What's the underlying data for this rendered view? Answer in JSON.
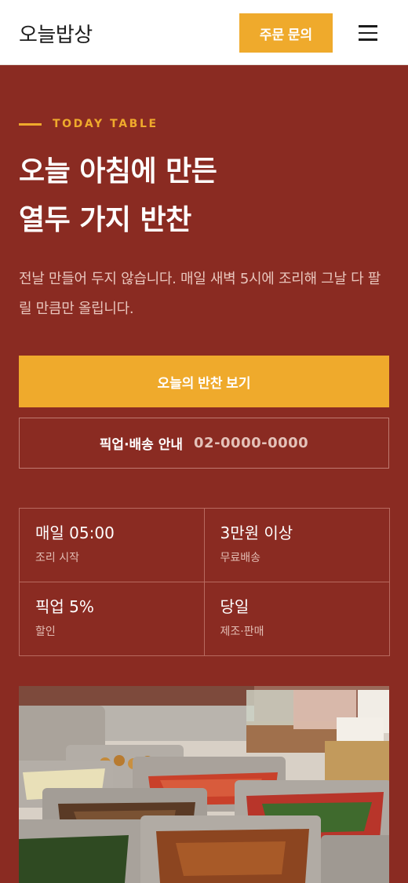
{
  "header": {
    "logo": "오늘밥상",
    "order_button": "주문 문의",
    "menu_icon": "hamburger-menu-icon"
  },
  "hero": {
    "eyebrow": "TODAY TABLE",
    "title_line1": "오늘 아침에 만든",
    "title_line2": "열두 가지 반찬",
    "description": "전날 만들어 두지 않습니다. 매일 새벽 5시에 조리해 그날 다 팔릴 만큼만 올립니다.",
    "cta_button": "오늘의 반찬 보기",
    "phone_label": "픽업·배송 안내",
    "phone_number": "02-0000-0000"
  },
  "info": [
    {
      "main": "매일 05:00",
      "sub": "조리 시작"
    },
    {
      "main": "3만원 이상",
      "sub": "무료배송"
    },
    {
      "main": "픽업 5%",
      "sub": "할인"
    },
    {
      "main": "당일",
      "sub": "제조·판매"
    }
  ],
  "colors": {
    "brand_red": "#8a2b22",
    "accent_yellow": "#efaa2c",
    "header_bg": "#ffffff"
  }
}
